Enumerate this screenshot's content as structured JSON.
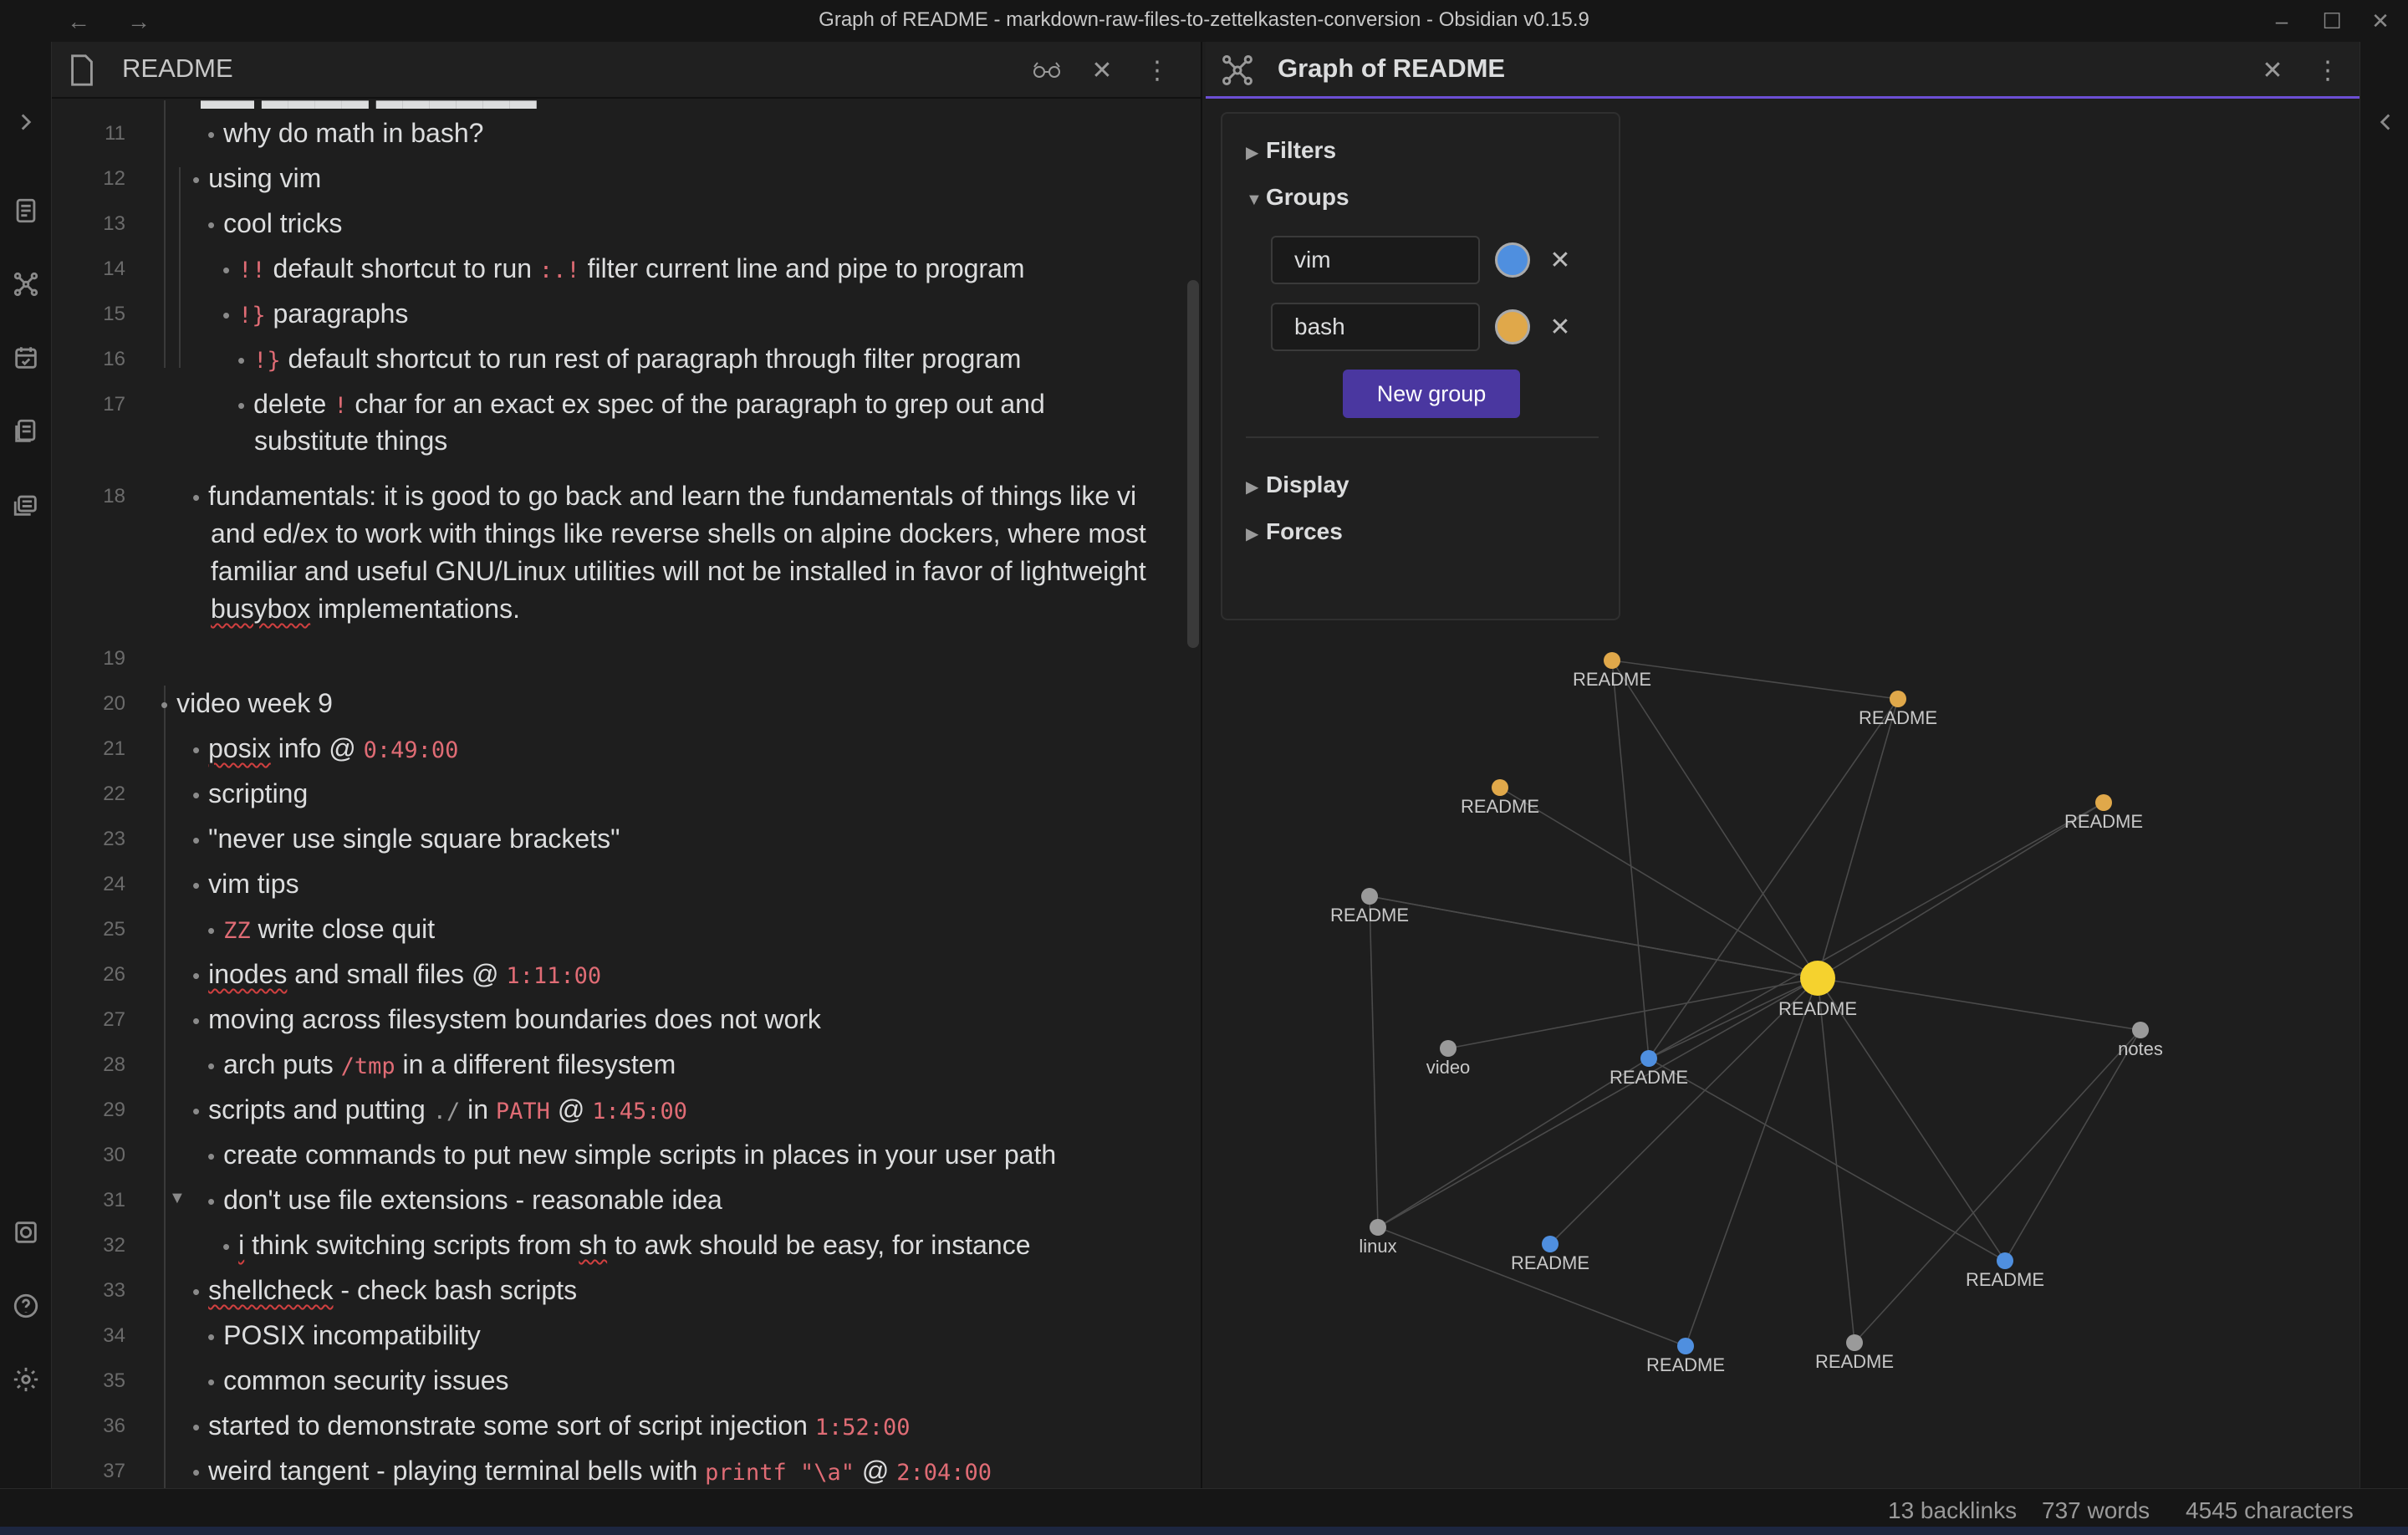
{
  "window": {
    "title": "Graph of README - markdown-raw-files-to-zettelkasten-conversion - Obsidian v0.15.9"
  },
  "editor": {
    "tab_title": "README",
    "lines": [
      {
        "n": "11",
        "text": "why do math in bash?"
      },
      {
        "n": "12",
        "text": "using vim"
      },
      {
        "n": "13",
        "text": "cool tricks"
      },
      {
        "n": "14",
        "c1": "!!",
        "t1": "default shortcut to run",
        "c2": ":.!",
        "t2": "filter current line and pipe to program"
      },
      {
        "n": "15",
        "c1": "!}",
        "t1": "paragraphs"
      },
      {
        "n": "16",
        "c1": "!}",
        "t1": "default shortcut to run rest of paragraph through filter program"
      },
      {
        "n": "17",
        "t0": "delete",
        "c1": "!",
        "t1": "char for an exact ex spec of the paragraph to grep out and",
        "cont": "substitute things"
      },
      {
        "n": "18",
        "text": "fundamentals: it is good to go back and learn the fundamentals of things like vi",
        "cont1": "and ed/ex to work with things like reverse shells on alpine dockers, where most",
        "cont2": "familiar and useful GNU/Linux utilities will not be installed in favor of lightweight",
        "cont3a": "busybox",
        "cont3b": "implementations."
      },
      {
        "n": "19",
        "text": ""
      },
      {
        "n": "20",
        "text": "video week 9"
      },
      {
        "n": "21",
        "t0": "posix",
        "t1": "info @",
        "c1": "0:49:00"
      },
      {
        "n": "22",
        "text": "scripting"
      },
      {
        "n": "23",
        "text": "\"never use single square brackets\""
      },
      {
        "n": "24",
        "text": "vim tips"
      },
      {
        "n": "25",
        "c1": "ZZ",
        "t1": "write close quit"
      },
      {
        "n": "26",
        "t0": "inodes",
        "t1": "and small files @",
        "c1": "1:11:00"
      },
      {
        "n": "27",
        "text": "moving across filesystem boundaries does not work"
      },
      {
        "n": "28",
        "t0": "arch puts",
        "c1": "/tmp",
        "t1": "in a different filesystem"
      },
      {
        "n": "29",
        "t0": "scripts and putting",
        "cg": "./",
        "t1": "in",
        "c1": "PATH",
        "t2": "@",
        "c2": "1:45:00"
      },
      {
        "n": "30",
        "text": "create commands to put new simple scripts in places in your user path"
      },
      {
        "n": "31",
        "text": "don't use file extensions - reasonable idea"
      },
      {
        "n": "32",
        "t0": "i",
        "t1": "think switching scripts from",
        "t2": "sh",
        "t3": "to awk should be easy, for instance"
      },
      {
        "n": "33",
        "t0": "shellcheck",
        "t1": "- check bash scripts"
      },
      {
        "n": "34",
        "text": "POSIX incompatibility"
      },
      {
        "n": "35",
        "text": "common security issues"
      },
      {
        "n": "36",
        "t0": "started to demonstrate some sort of script injection",
        "c1": "1:52:00"
      },
      {
        "n": "37",
        "t0": "weird tangent - playing terminal bells with",
        "c1": "printf \"\\a\"",
        "t1": "@",
        "c2": "2:04:00"
      }
    ]
  },
  "graph": {
    "tab_title": "Graph of README",
    "controls": {
      "filters": "Filters",
      "groups": "Groups",
      "group_items": [
        {
          "query": "vim",
          "color": "#4f8fdf"
        },
        {
          "query": "bash",
          "color": "#e0a84a"
        }
      ],
      "new_group": "New group",
      "display": "Display",
      "forces": "Forces"
    },
    "colors": {
      "center": "#f5d22e",
      "bash": "#e0a84a",
      "vim": "#4f8fdf",
      "default": "#9a9a9a",
      "edge": "#4a4a4a"
    },
    "node_labels": [
      "README",
      "README",
      "README",
      "README",
      "README",
      "README",
      "video",
      "README",
      "notes",
      "linux",
      "README",
      "README",
      "README",
      "README"
    ]
  },
  "status": {
    "backlinks": "13 backlinks",
    "words": "737 words",
    "characters": "4545 characters"
  }
}
